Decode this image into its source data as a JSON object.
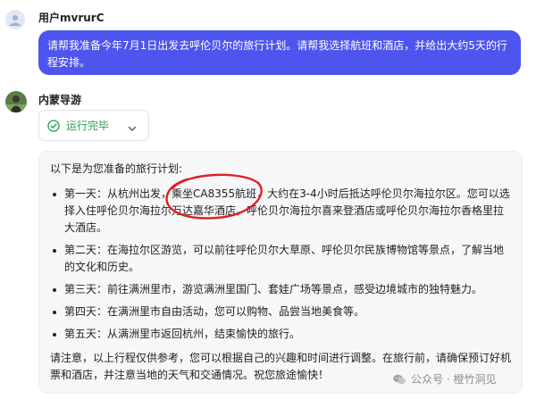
{
  "user": {
    "name": "用户mvrurC",
    "message": "请帮我准备今年7月1日出发去呼伦贝尔的旅行计划。请帮我选择航班和酒店，并给出大约5天的行程安排。"
  },
  "bot": {
    "name": "内蒙导游",
    "status": "运行完毕",
    "intro": "以下是为您准备的旅行计划:",
    "days": [
      "第一天：从杭州出发，乘坐CA8355航班，大约在3-4小时后抵达呼伦贝尔海拉尔区。您可以选择入住呼伦贝尔海拉尔万达嘉华酒店，呼伦贝尔海拉尔喜来登酒店或呼伦贝尔海拉尔香格里拉大酒店。",
      "第二天：在海拉尔区游览，可以前往呼伦贝尔大草原、呼伦贝尔民族博物馆等景点，了解当地的文化和历史。",
      "第三天：前往满洲里市，游览满洲里国门、套娃广场等景点，感受边境城市的独特魅力。",
      "第四天：在满洲里市自由活动，您可以购物、品尝当地美食等。",
      "第五天：从满洲里市返回杭州，结束愉快的旅行。"
    ],
    "outro": "请注意，以上行程仅供参考，您可以根据自己的兴趣和时间进行调整。在旅行前，请确保预订好机票和酒店，并注意当地的天气和交通情况。祝您旅途愉快！"
  },
  "watermark": {
    "text": "公众号 · 橙竹洞见"
  },
  "colors": {
    "user_bubble": "#4e55ee",
    "status_green": "#2e9d4f",
    "annotation_red": "#e02020",
    "card_bg": "#f6f7f9"
  },
  "icons": {
    "user_avatar": "person-icon",
    "bot_avatar": "bot-avatar-image",
    "status": "check-circle-icon",
    "expand": "chevron-down-icon",
    "watermark": "wechat-icon"
  }
}
